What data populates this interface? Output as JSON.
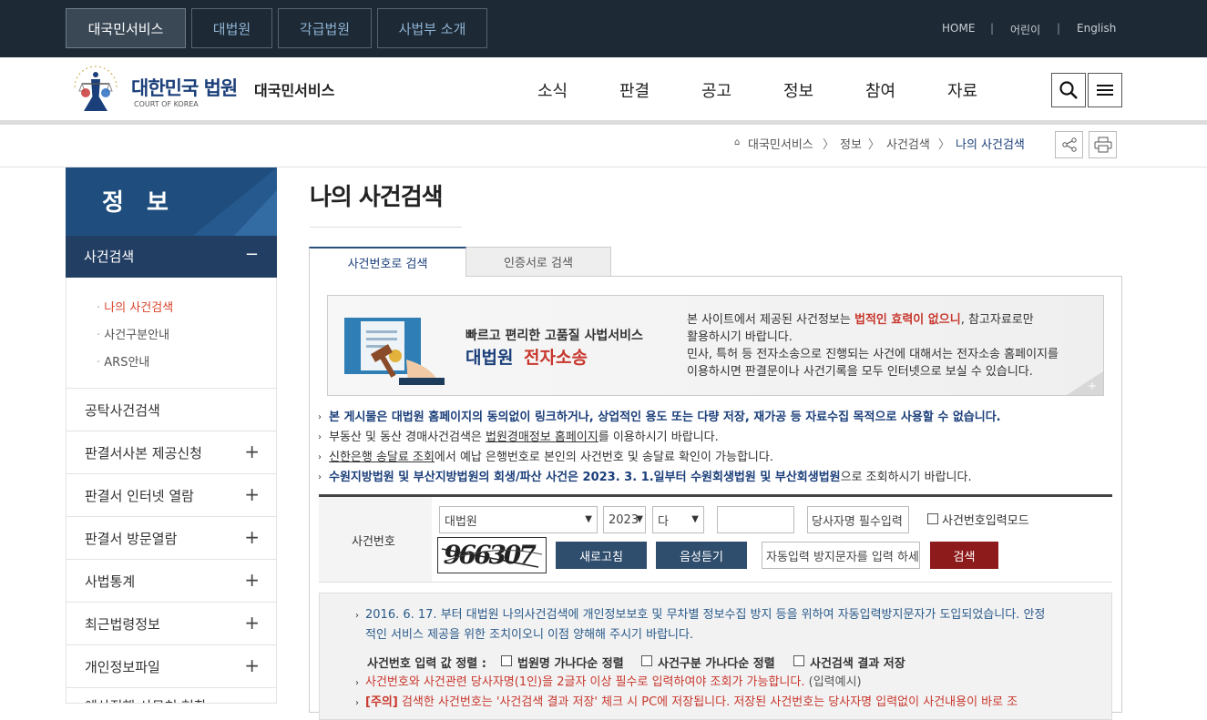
{
  "top_nav": {
    "tabs": [
      "대국민서비스",
      "대법원",
      "각급법원",
      "사법부 소개"
    ],
    "utility_links": [
      "HOME",
      "어린이",
      "English"
    ]
  },
  "header": {
    "logo_main": "대한민국 법원",
    "logo_sub": "COURT OF KOREA",
    "service_name": "대국민서비스",
    "menu": [
      "소식",
      "판결",
      "공고",
      "정보",
      "참여",
      "자료"
    ]
  },
  "breadcrumb": [
    "대국민서비스",
    "정보",
    "사건검색",
    "나의 사건검색"
  ],
  "sidebar": {
    "title": "정 보",
    "active_section": "사건검색",
    "active_symbol": "−",
    "sub_items": [
      "나의 사건검색",
      "사건구분안내",
      "ARS안내"
    ],
    "items": [
      {
        "label": "공탁사건검색",
        "expand": ""
      },
      {
        "label": "판결서사본 제공신청",
        "expand": "+"
      },
      {
        "label": "판결서 인터넷 열람",
        "expand": "+"
      },
      {
        "label": "판결서 방문열람",
        "expand": "+"
      },
      {
        "label": "사법통계",
        "expand": "+"
      },
      {
        "label": "최근법령정보",
        "expand": "+"
      },
      {
        "label": "개인정보파일",
        "expand": "+"
      },
      {
        "label": "예산집행 사무처 현황",
        "expand": ""
      }
    ]
  },
  "main": {
    "page_title": "나의 사건검색",
    "tabs": [
      "사건번호로 검색",
      "인증서로 검색"
    ],
    "banner": {
      "tagline": "빠르고 편리한 고품질 사법서비스",
      "name_a": "대법원",
      "name_b": "전자소송",
      "desc1_a": "본 사이트에서 제공된 사건정보는",
      "desc1_b": "법적인 효력이 없으니",
      "desc1_c": ", 참고자료로만",
      "desc2": "활용하시기 바랍니다.",
      "desc3": "민사, 특허 등 전자소송으로 진행되는 사건에 대해서는 전자소송 홈페이지를",
      "desc4": "이용하시면 판결문이나 사건기록을 모두 인터넷으로 보실 수 있습니다.",
      "more": "+"
    },
    "notices": {
      "n1": "본 게시물은 대법원 홈페이지의 동의없이 링크하거나, 상업적인 용도 또는 다량 저장, 재가공 등 자료수집 목적으로 사용할 수 없습니다.",
      "n2a": "부동산 및 동산 경매사건검색은 ",
      "n2b": "법원경매정보 홈페이지",
      "n2c": "를 이용하시기 바랍니다.",
      "n3a": "신한은행 송달료 조회",
      "n3b": "에서 예납 은행번호로 본인의 사건번호 및 송달료 확인이 가능합니다.",
      "n4a": "수원지방법원 및 부산지방법원의 회생/파산 사건은 2023. 3. 1.일부터 수원회생법원 및 부산회생법원",
      "n4b": "으로 조회하시기 바랍니다."
    },
    "form": {
      "label": "사건번호",
      "court": "대법원",
      "year": "2023",
      "case_type": "다",
      "case_number": "",
      "party_placeholder": "당사자명 필수입력",
      "mode_label": "사건번호입력모드",
      "captcha_text": "966307",
      "refresh_button": "새로고침",
      "audio_button": "음성듣기",
      "captcha_placeholder": "자동입력 방지문자를 입력 하세요",
      "search_button": "검색"
    },
    "info": {
      "line1": "2016. 6. 17. 부터 대법원 나의사건검색에 개인정보보호 및 무차별 정보수집 방지 등을 위하여 자동입력방지문자가 도입되었습니다. 안정",
      "line2": "적인 서비스 제공을 위한 조치이오니 이점 양해해 주시기 바랍니다.",
      "sort_label": "사건번호 입력 값 정렬 :",
      "sort_options": [
        "법원명 가나다순 정렬",
        "사건구분 가나다순 정렬",
        "사건검색 결과 저장"
      ],
      "line3": "사건번호와 사건관련 당사자명(1인)을 2글자 이상 필수로 입력하여야 조회가 가능합니다.",
      "line3_example": "(입력예시)",
      "line4_tag": "[주의]",
      "line4": "검색한 사건번호는 '사건검색 결과 저장' 체크 시 PC에 저장됩니다. 저장된 사건번호는 당사자명 입력없이 사건내용이 바로 조"
    }
  }
}
